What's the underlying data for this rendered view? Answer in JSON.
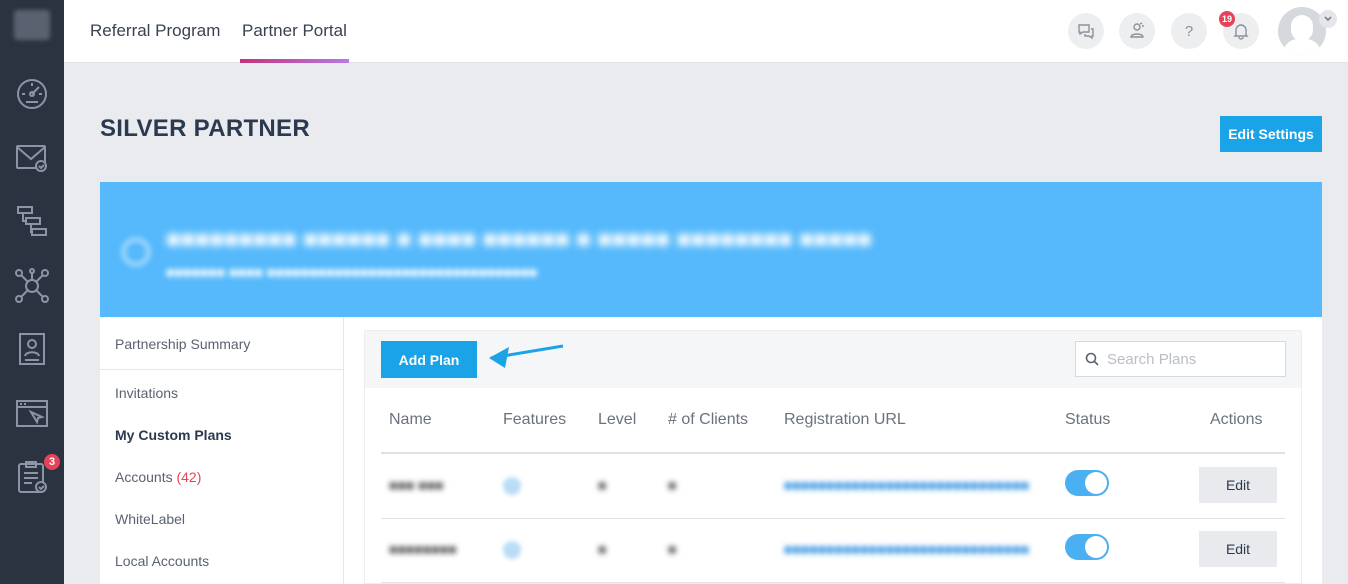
{
  "nav_rail": {
    "icons": [
      "dashboard-icon",
      "mail-icon",
      "workflow-icon",
      "network-icon",
      "profile-card-icon",
      "browser-icon",
      "clipboard-icon"
    ],
    "clipboard_badge": "3"
  },
  "topbar": {
    "tabs": [
      {
        "label": "Referral Program",
        "active": false
      },
      {
        "label": "Partner Portal",
        "active": true
      }
    ],
    "help_label": "?",
    "notification_count": "19"
  },
  "page": {
    "title": "SILVER PARTNER",
    "edit_settings_label": "Edit Settings"
  },
  "sidenav": {
    "items": [
      {
        "label": "Partnership Summary"
      },
      {
        "label": "Invitations"
      },
      {
        "label": "My Custom Plans",
        "active": true
      },
      {
        "label": "Accounts",
        "count": "(42)"
      },
      {
        "label": "WhiteLabel"
      },
      {
        "label": "Local Accounts"
      }
    ]
  },
  "plans": {
    "add_plan_label": "Add Plan",
    "search_placeholder": "Search Plans",
    "columns": [
      "Name",
      "Features",
      "Level",
      "# of Clients",
      "Registration URL",
      "Status",
      "Actions"
    ],
    "rows": [
      {
        "status_on": true,
        "action_label": "Edit"
      },
      {
        "status_on": true,
        "action_label": "Edit"
      }
    ]
  },
  "colors": {
    "accent": "#1aa3e6",
    "banner": "#55b9fb",
    "rail": "#2c3340",
    "badge": "#e5435a"
  }
}
